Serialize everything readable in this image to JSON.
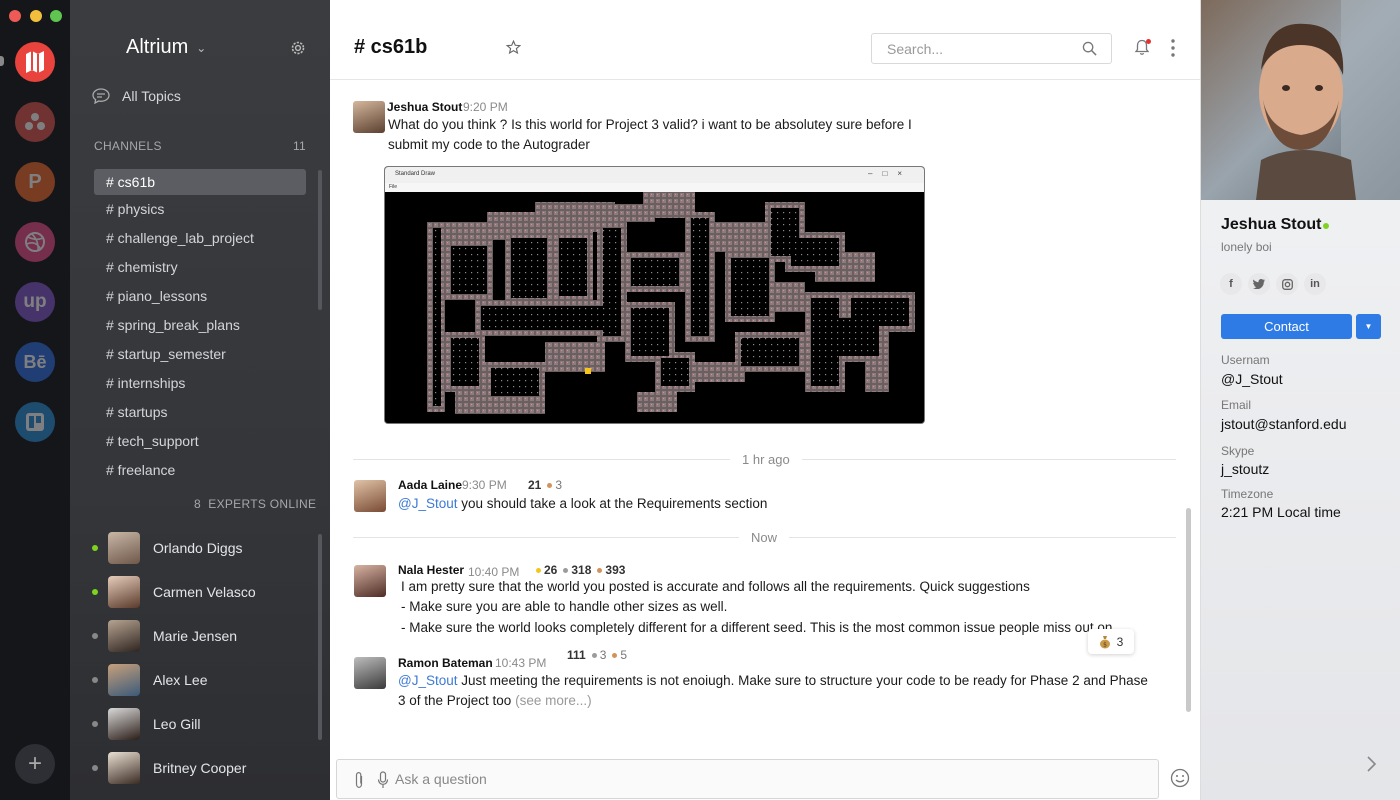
{
  "sidebar": {
    "workspace": "Altrium",
    "all_topics": "All Topics",
    "channels_label": "CHANNELS",
    "channels_count": "11",
    "channels": [
      {
        "label": "# cs61b",
        "active": true
      },
      {
        "label": "# physics"
      },
      {
        "label": "# challenge_lab_project"
      },
      {
        "label": "# chemistry"
      },
      {
        "label": "# piano_lessons"
      },
      {
        "label": "# spring_break_plans"
      },
      {
        "label": "# startup_semester"
      },
      {
        "label": "# internships"
      },
      {
        "label": "# startups"
      },
      {
        "label": "# tech_support"
      },
      {
        "label": "# freelance"
      }
    ],
    "experts_count": "8",
    "experts_label": "EXPERTS ONLINE",
    "experts": [
      {
        "name": "Orlando Diggs",
        "online": true
      },
      {
        "name": "Carmen Velasco",
        "online": true
      },
      {
        "name": "Marie Jensen",
        "online": false
      },
      {
        "name": "Alex Lee",
        "online": false
      },
      {
        "name": "Leo Gill",
        "online": false
      },
      {
        "name": "Britney Cooper",
        "online": false
      }
    ]
  },
  "dock": {
    "apps": [
      "logo-icon",
      "community-icon",
      "producthunt-icon",
      "dribbble-icon",
      "upwork-icon",
      "behance-icon",
      "trello-icon"
    ],
    "add_label": "+"
  },
  "header": {
    "channel_title": "# cs61b",
    "search_placeholder": "Search..."
  },
  "messages": [
    {
      "author": "Jeshua Stout",
      "time": "9:20 PM",
      "text": "What do you think ? Is this world for Project 3 valid? i want to be absolutey sure before I submit my code to the Autograder",
      "attachment": {
        "window_title": "Standard Draw",
        "menu": "File"
      }
    },
    {
      "author": "Aada Laine",
      "time": "9:30 PM",
      "score": {
        "points": "21",
        "bronze": "3"
      },
      "mention": "@J_Stout",
      "text": " you should take a look at the Requirements section"
    },
    {
      "author": "Nala Hester",
      "time": "10:40 PM",
      "score": {
        "gold": "26",
        "silver": "318",
        "bronze": "393"
      },
      "lines": [
        "I am pretty sure that the world you posted is accurate and follows all the requirements. Quick suggestions",
        "- Make sure you are able to handle other sizes as well.",
        "- Make sure the world looks completely different for a different seed. This is the most common issue people miss out on."
      ],
      "reaction": {
        "icon": "money-bag-icon",
        "count": "3"
      }
    },
    {
      "author": "Ramon Bateman",
      "time": "10:43 PM",
      "score": {
        "points": "111",
        "silver": "3",
        "bronze": "5"
      },
      "mention": "@J_Stout",
      "text": " Just meeting the requirements is not enoiugh. Make sure to structure your code to be ready for Phase 2 and Phase 3 of the Project too",
      "see_more": "(see more...)"
    }
  ],
  "dividers": {
    "first": "1 hr ago",
    "second": "Now"
  },
  "composer": {
    "placeholder": "Ask a question"
  },
  "profile": {
    "name": "Jeshua Stout",
    "bio": "lonely boi",
    "socials": [
      "f",
      "t",
      "ig",
      "in"
    ],
    "contact_label": "Contact",
    "fields": [
      {
        "label": "Usernam",
        "value": "@J_Stout"
      },
      {
        "label": "Email",
        "value": "jstout@stanford.edu"
      },
      {
        "label": "Skype",
        "value": "j_stoutz"
      },
      {
        "label": "Timezone",
        "value": "2:21 PM Local time"
      }
    ]
  },
  "colors": {
    "accent": "#2f7be5",
    "mention": "#3d7ad6",
    "online": "#7ed321",
    "gold": "#f5c518",
    "silver": "#9b9b9b",
    "bronze": "#d2935a"
  }
}
